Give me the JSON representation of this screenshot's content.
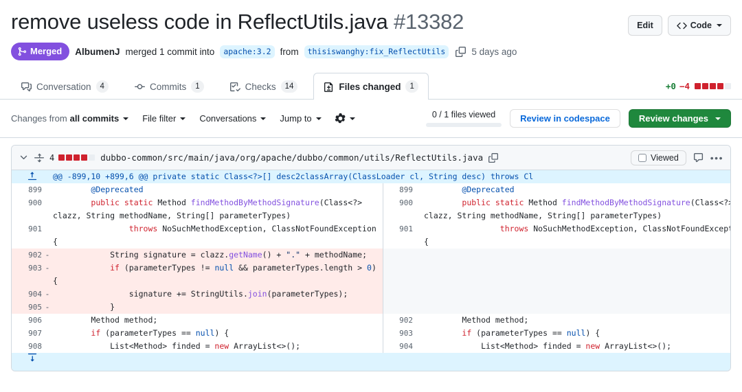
{
  "header": {
    "title": "remove useless code in ReflectUtils.java",
    "number": "#13382",
    "edit_label": "Edit",
    "code_label": "Code"
  },
  "state": {
    "badge": "Merged",
    "author": "AlbumenJ",
    "merged_text": "merged 1 commit into",
    "base_ref": "apache:3.2",
    "from_text": "from",
    "head_ref": "thisiswanghy:fix_ReflectUtils",
    "time": "5 days ago"
  },
  "tabs": [
    {
      "label": "Conversation",
      "count": "4",
      "icon": "comment-discussion-icon",
      "selected": false
    },
    {
      "label": "Commits",
      "count": "1",
      "icon": "git-commit-icon",
      "selected": false
    },
    {
      "label": "Checks",
      "count": "14",
      "icon": "checklist-icon",
      "selected": false
    },
    {
      "label": "Files changed",
      "count": "1",
      "icon": "file-diff-icon",
      "selected": true
    }
  ],
  "diffstat": {
    "additions": "+0",
    "deletions": "−4",
    "blocks": [
      "del",
      "del",
      "del",
      "del",
      "neutral"
    ]
  },
  "toolbar": {
    "changes_from_lead": "Changes from",
    "changes_from_value": "all commits",
    "file_filter": "File filter",
    "conversations": "Conversations",
    "jump_to": "Jump to",
    "gear": "gear-icon",
    "files_viewed": "0 / 1 files viewed",
    "review_codespace": "Review in codespace",
    "review_changes": "Review changes"
  },
  "file": {
    "change_count": "4",
    "blocks": [
      "del",
      "del",
      "del",
      "del",
      "neutral"
    ],
    "path": "dubbo-common/src/main/java/org/apache/dubbo/common/utils/ReflectUtils.java",
    "viewed_label": "Viewed",
    "hunk_header": "@@ -899,10 +899,6 @@ private static Class<?>[] desc2classArray(ClassLoader cl, String desc) throws Cl"
  },
  "diff_rows": [
    {
      "type": "context",
      "left_num": "899",
      "right_num": "899",
      "left_mark": "",
      "right_mark": "",
      "code_parts": [
        {
          "t": "        ",
          "c": "pl"
        },
        {
          "t": "@Deprecated",
          "c": "an"
        }
      ]
    },
    {
      "type": "context",
      "left_num": "900",
      "right_num": "900",
      "left_mark": "",
      "right_mark": "",
      "code_parts": [
        {
          "t": "        ",
          "c": "pl"
        },
        {
          "t": "public static",
          "c": "k"
        },
        {
          "t": " Method ",
          "c": "pl"
        },
        {
          "t": "findMethodByMethodSignature",
          "c": "fn"
        },
        {
          "t": "(Class<?> clazz, String methodName, String[] parameterTypes)",
          "c": "pl"
        }
      ]
    },
    {
      "type": "context",
      "left_num": "901",
      "right_num": "901",
      "left_mark": "",
      "right_mark": "",
      "code_parts": [
        {
          "t": "                ",
          "c": "pl"
        },
        {
          "t": "throws",
          "c": "k"
        },
        {
          "t": " NoSuchMethodException, ClassNotFoundException {",
          "c": "pl"
        }
      ]
    },
    {
      "type": "deletion",
      "left_num": "902",
      "right_num": "",
      "left_mark": "-",
      "right_mark": "",
      "code_parts": [
        {
          "t": "            String signature = clazz.",
          "c": "pl"
        },
        {
          "t": "getName",
          "c": "fn"
        },
        {
          "t": "() + ",
          "c": "pl"
        },
        {
          "t": "\".\"",
          "c": "st"
        },
        {
          "t": " + methodName;",
          "c": "pl"
        }
      ]
    },
    {
      "type": "deletion",
      "left_num": "903",
      "right_num": "",
      "left_mark": "-",
      "right_mark": "",
      "code_parts": [
        {
          "t": "            ",
          "c": "pl"
        },
        {
          "t": "if",
          "c": "k"
        },
        {
          "t": " (parameterTypes != ",
          "c": "pl"
        },
        {
          "t": "null",
          "c": "nl"
        },
        {
          "t": " && parameterTypes.length > ",
          "c": "pl"
        },
        {
          "t": "0",
          "c": "nl"
        },
        {
          "t": ") {",
          "c": "pl"
        }
      ]
    },
    {
      "type": "deletion",
      "left_num": "904",
      "right_num": "",
      "left_mark": "-",
      "right_mark": "",
      "code_parts": [
        {
          "t": "                signature += StringUtils.",
          "c": "pl"
        },
        {
          "t": "join",
          "c": "fn"
        },
        {
          "t": "(parameterTypes);",
          "c": "pl"
        }
      ]
    },
    {
      "type": "deletion",
      "left_num": "905",
      "right_num": "",
      "left_mark": "-",
      "right_mark": "",
      "code_parts": [
        {
          "t": "            }",
          "c": "pl"
        }
      ]
    },
    {
      "type": "context",
      "left_num": "906",
      "right_num": "902",
      "left_mark": "",
      "right_mark": "",
      "code_parts": [
        {
          "t": "        Method method;",
          "c": "pl"
        }
      ]
    },
    {
      "type": "context",
      "left_num": "907",
      "right_num": "903",
      "left_mark": "",
      "right_mark": "",
      "code_parts": [
        {
          "t": "        ",
          "c": "pl"
        },
        {
          "t": "if",
          "c": "k"
        },
        {
          "t": " (parameterTypes == ",
          "c": "pl"
        },
        {
          "t": "null",
          "c": "nl"
        },
        {
          "t": ") {",
          "c": "pl"
        }
      ]
    },
    {
      "type": "context",
      "left_num": "908",
      "right_num": "904",
      "left_mark": "",
      "right_mark": "",
      "code_parts": [
        {
          "t": "            List<Method> finded = ",
          "c": "pl"
        },
        {
          "t": "new",
          "c": "k"
        },
        {
          "t": " ArrayList<>();",
          "c": "pl"
        }
      ]
    }
  ],
  "colors": {
    "merged_purple": "#8250df",
    "deletion_red": "#cf222e",
    "addition_green": "#1a7f37",
    "primary_green": "#1f883d",
    "link_blue": "#0969da",
    "hunk_blue": "#ddf4ff",
    "del_bg": "#ffebe9"
  }
}
